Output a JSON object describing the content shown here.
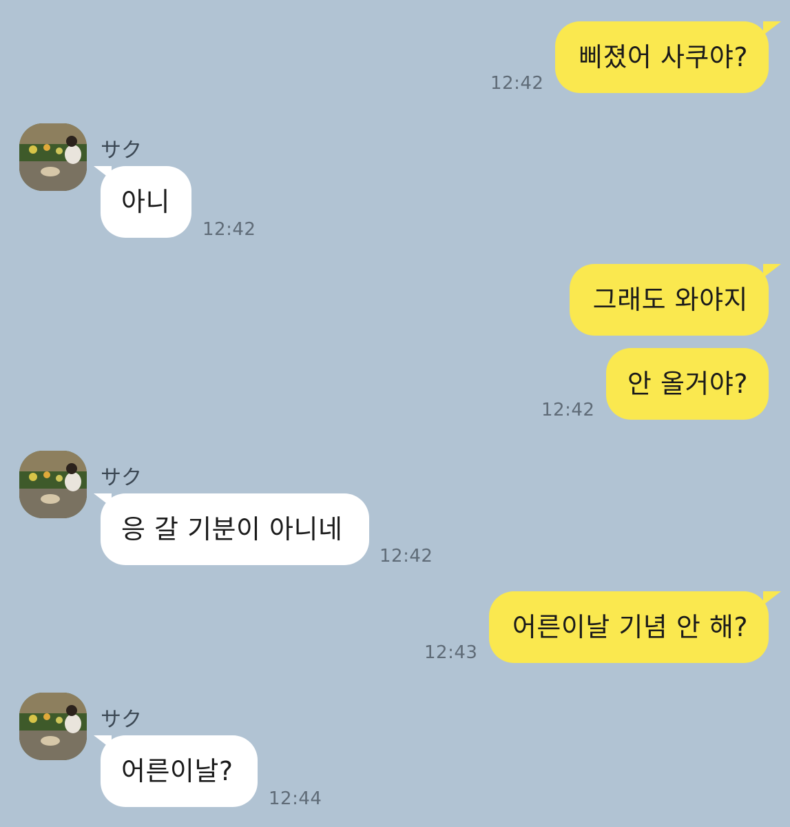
{
  "chat": {
    "sender_name": "サク",
    "messages": [
      {
        "from": "me",
        "text": "삐졌어 사쿠야?",
        "time": "12:42"
      },
      {
        "from": "them",
        "text": "아니",
        "time": "12:42"
      },
      {
        "from": "me",
        "text": "그래도 와야지",
        "time": ""
      },
      {
        "from": "me",
        "text": "안 올거야?",
        "time": "12:42"
      },
      {
        "from": "them",
        "text": "응 갈 기분이 아니네",
        "time": "12:42"
      },
      {
        "from": "me",
        "text": "어른이날 기념 안 해?",
        "time": "12:43"
      },
      {
        "from": "them",
        "text": "어른이날?",
        "time": "12:44"
      }
    ]
  },
  "colors": {
    "background": "#b1c3d3",
    "my_bubble": "#fae84f",
    "their_bubble": "#ffffff",
    "time_text": "#5f6b77"
  },
  "icons": {
    "avatar": "profile-photo"
  }
}
